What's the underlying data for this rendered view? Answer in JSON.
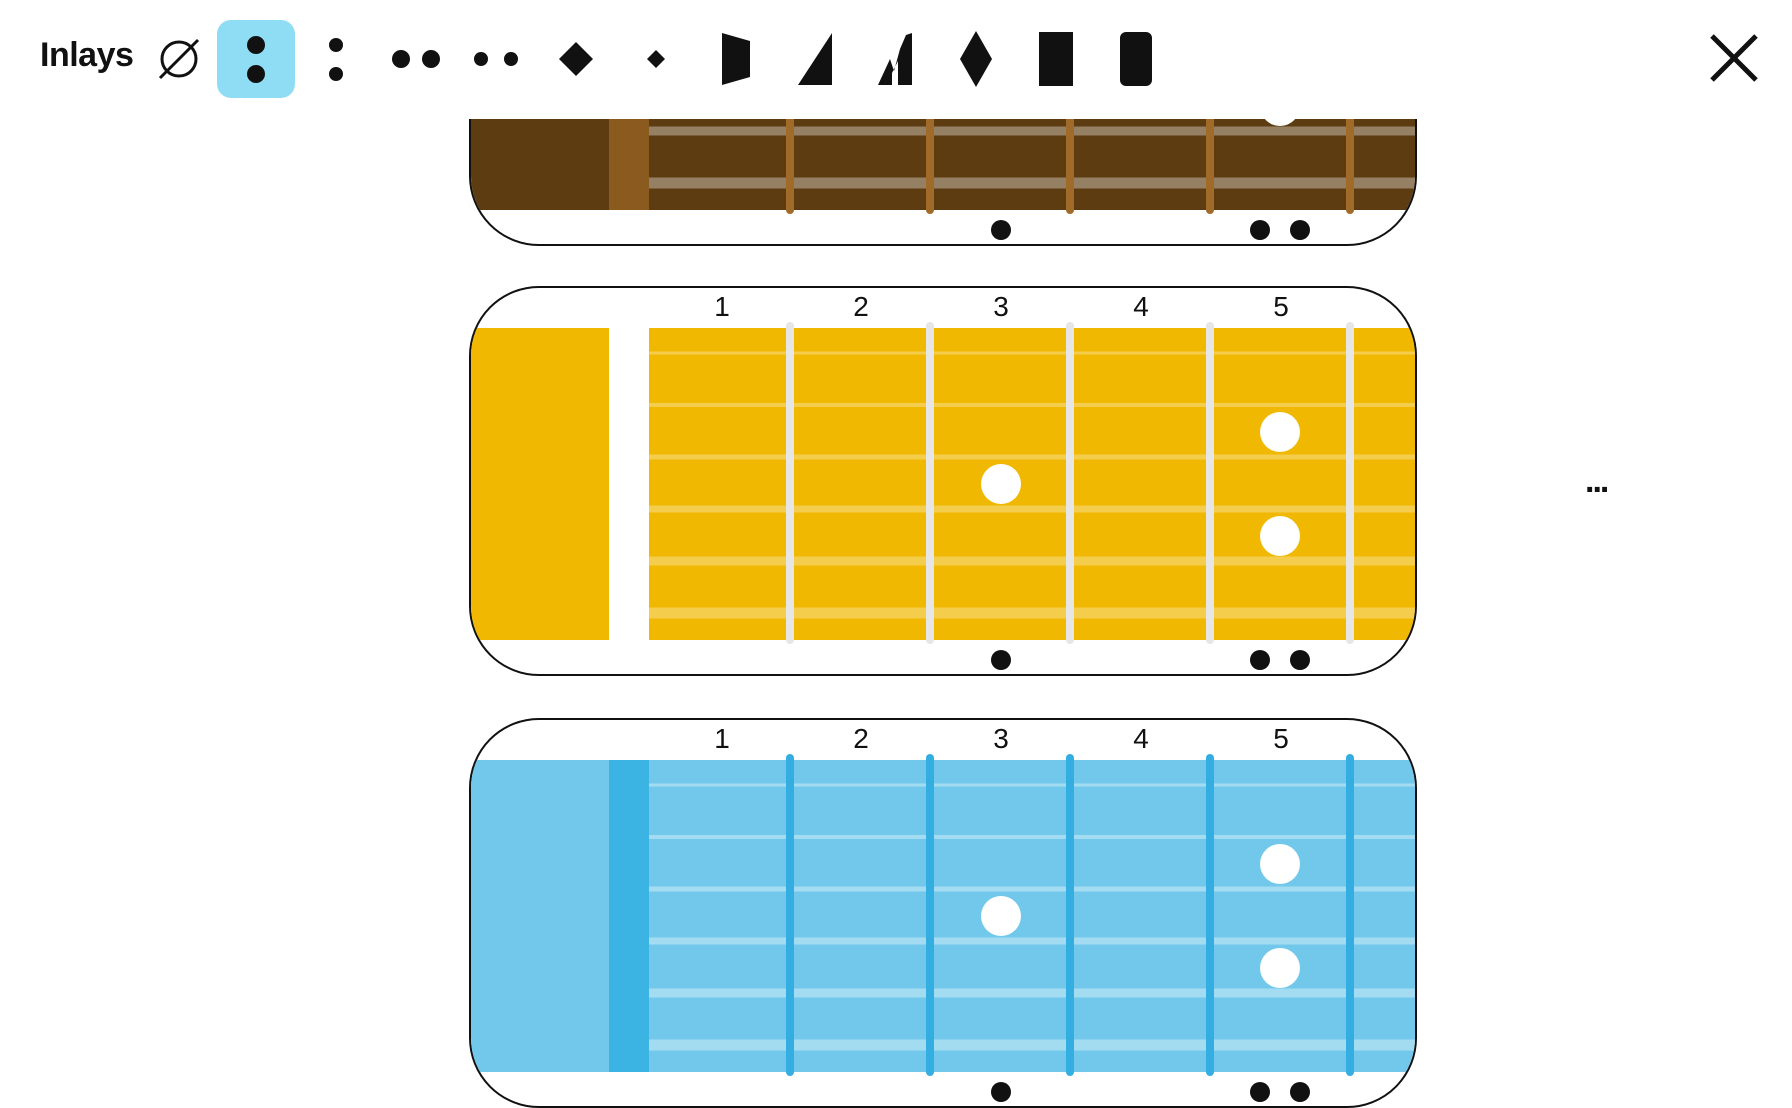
{
  "toolbar": {
    "title": "Inlays",
    "options": [
      {
        "name": "none-icon",
        "selected": false
      },
      {
        "name": "double-dot-vertical-large-icon",
        "selected": true
      },
      {
        "name": "double-dot-vertical-small-icon",
        "selected": false
      },
      {
        "name": "double-dot-horizontal-large-icon",
        "selected": false
      },
      {
        "name": "double-dot-horizontal-small-icon",
        "selected": false
      },
      {
        "name": "diamond-large-icon",
        "selected": false
      },
      {
        "name": "diamond-small-icon",
        "selected": false
      },
      {
        "name": "trapezoid-icon",
        "selected": false
      },
      {
        "name": "shark-fin-icon",
        "selected": false
      },
      {
        "name": "split-shark-fin-icon",
        "selected": false
      },
      {
        "name": "tall-diamond-icon",
        "selected": false
      },
      {
        "name": "block-icon",
        "selected": false
      },
      {
        "name": "rounded-block-icon",
        "selected": false
      }
    ],
    "close_icon": "close-icon"
  },
  "fret_numbers": [
    "1",
    "2",
    "3",
    "4",
    "5"
  ],
  "fretboards": [
    {
      "name": "rosewood",
      "board": "#5e3c12",
      "nut": "#8b5a1f",
      "fret": "#a06a28",
      "string": "#ffffff",
      "string_opacity": 0.35,
      "inlay": "#ffffff"
    },
    {
      "name": "maple",
      "board": "#f0b800",
      "nut": "#ffffff",
      "fret": "#e6e6e6",
      "string": "#ffffff",
      "string_opacity": 0.3,
      "inlay": "#ffffff"
    },
    {
      "name": "blue",
      "board": "#72c8ea",
      "nut": "#3bb4e3",
      "fret": "#34ade0",
      "string": "#ffffff",
      "string_opacity": 0.35,
      "inlay": "#ffffff"
    }
  ],
  "more_label": "..."
}
